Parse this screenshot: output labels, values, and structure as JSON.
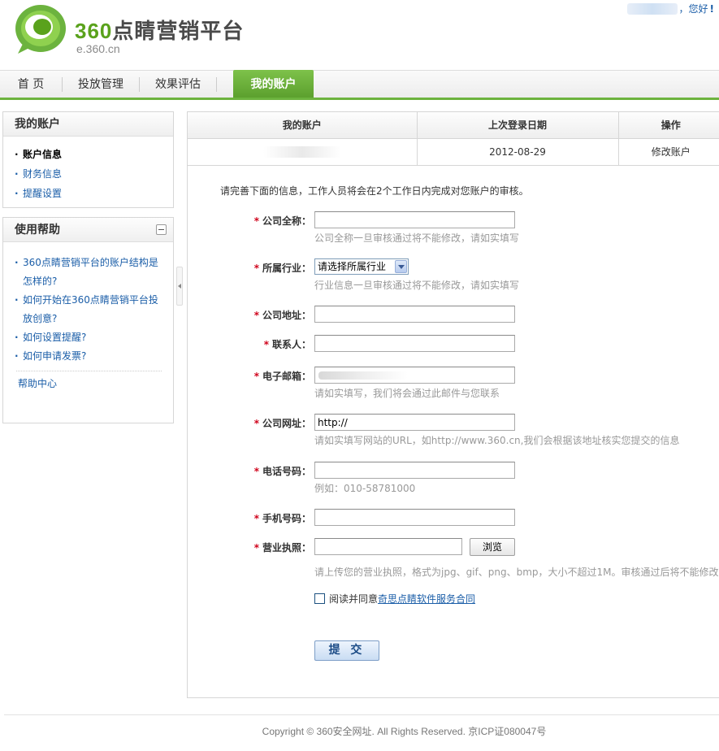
{
  "header": {
    "logo_title_prefix": "360",
    "logo_title_rest": "点睛营销平台",
    "logo_sub": "e.360.cn",
    "greeting": "，您好",
    "greeting_mark": "!"
  },
  "nav": {
    "items": [
      {
        "label": "首 页"
      },
      {
        "label": "投放管理"
      },
      {
        "label": "效果评估"
      },
      {
        "label": "我的账户"
      }
    ]
  },
  "sidebar": {
    "account": {
      "title": "我的账户",
      "items": [
        {
          "label": "账户信息"
        },
        {
          "label": "财务信息"
        },
        {
          "label": "提醒设置"
        }
      ]
    },
    "help": {
      "title": "使用帮助",
      "items": [
        {
          "label": "360点睛营销平台的账户结构是怎样的?"
        },
        {
          "label": "如何开始在360点睛营销平台投放创意?"
        },
        {
          "label": "如何设置提醒?"
        },
        {
          "label": "如何申请发票?"
        }
      ],
      "center": "帮助中心"
    }
  },
  "account_table": {
    "headers": [
      "我的账户",
      "上次登录日期",
      "操作"
    ],
    "row": {
      "last_login": "2012-08-29",
      "action": "修改账户"
    }
  },
  "form": {
    "intro": "请完善下面的信息，工作人员将会在2个工作日内完成对您账户的审核。",
    "required_mark": "*",
    "fields": {
      "company_name": {
        "label": "公司全称：",
        "value": "",
        "hint": "公司全称一旦审核通过将不能修改，请如实填写"
      },
      "industry": {
        "label": "所属行业：",
        "selected": "请选择所属行业",
        "hint": "行业信息一旦审核通过将不能修改，请如实填写"
      },
      "address": {
        "label": "公司地址：",
        "value": ""
      },
      "contact": {
        "label": "联系人：",
        "value": ""
      },
      "email": {
        "label": "电子邮箱：",
        "hint": "请如实填写，我们将会通过此邮件与您联系"
      },
      "website": {
        "label": "公司网址：",
        "value": "http://",
        "hint": "请如实填写网站的URL，如http://www.360.cn,我们会根据该地址核实您提交的信息"
      },
      "phone": {
        "label": "电话号码：",
        "value": "",
        "hint": "例如：010-58781000"
      },
      "mobile": {
        "label": "手机号码：",
        "value": ""
      },
      "license": {
        "label": "营业执照：",
        "value": "",
        "browse": "浏览",
        "hint": "请上传您的营业执照，格式为jpg、gif、png、bmp，大小不超过1M。审核通过后将不能修改。"
      }
    },
    "agree_text": "阅读并同意",
    "agree_link": "奇思点睛软件服务合同",
    "submit": "提 交"
  },
  "footer": {
    "copyright": "Copyright © 360安全网址. All Rights Reserved. 京ICP证080047号"
  },
  "colors": {
    "brand_green": "#6cb33e",
    "link_blue": "#1b5ea8",
    "required_red": "#d0021b"
  }
}
